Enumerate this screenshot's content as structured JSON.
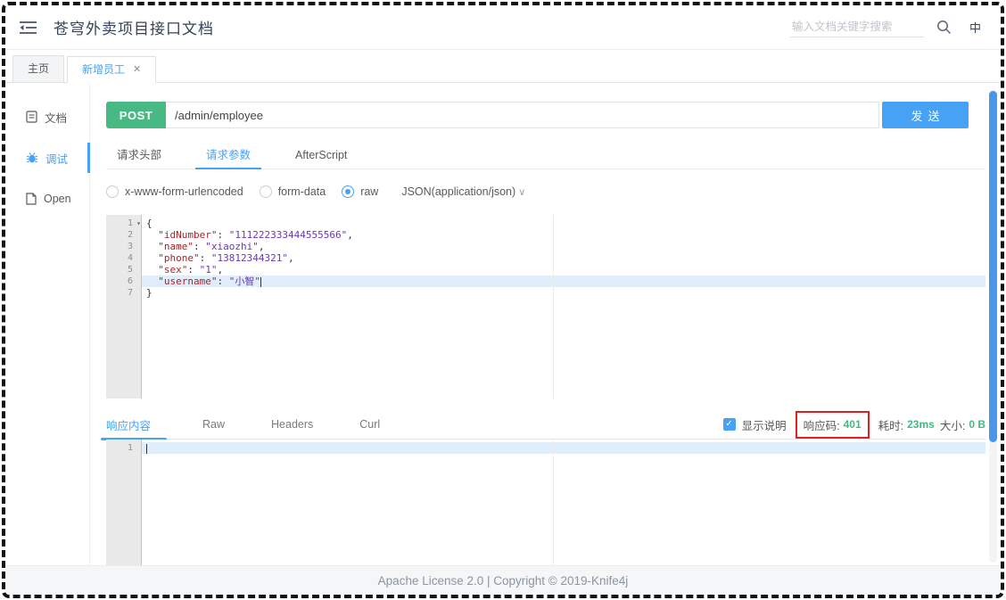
{
  "header": {
    "title": "苍穹外卖项目接口文档",
    "search_placeholder": "输入文档关键字搜索",
    "lang_label": "中"
  },
  "doc_tabs": {
    "home": "主页",
    "active": "新增员工",
    "close_glyph": "✕"
  },
  "sidebar": {
    "items": [
      {
        "label": "文档"
      },
      {
        "label": "调试"
      },
      {
        "label": "Open"
      }
    ]
  },
  "request": {
    "method": "POST",
    "url": "/admin/employee",
    "send_label": "发送",
    "tabs": [
      "请求头部",
      "请求参数",
      "AfterScript"
    ],
    "body_modes": [
      {
        "label": "x-www-form-urlencoded",
        "selected": false
      },
      {
        "label": "form-data",
        "selected": false
      },
      {
        "label": "raw",
        "selected": true
      }
    ],
    "content_type": "JSON(application/json)",
    "chevron_glyph": "∨"
  },
  "request_editor": {
    "fold_glyph": "▾",
    "line_numbers": [
      "1",
      "2",
      "3",
      "4",
      "5",
      "6",
      "7"
    ],
    "open_brace": "{",
    "close_brace": "}",
    "entries": [
      {
        "key": "\"idNumber\"",
        "colon": ": ",
        "value": "\"111222333444555566\"",
        "comma": ","
      },
      {
        "key": "\"name\"",
        "colon": ": ",
        "value": "\"xiaozhi\"",
        "comma": ","
      },
      {
        "key": "\"phone\"",
        "colon": ": ",
        "value": "\"13812344321\"",
        "comma": ","
      },
      {
        "key": "\"sex\"",
        "colon": ": ",
        "value": "\"1\"",
        "comma": ","
      },
      {
        "key": "\"username\"",
        "colon": ": ",
        "value": "\"小智\"",
        "comma": ""
      }
    ]
  },
  "response": {
    "tabs": [
      "响应内容",
      "Raw",
      "Headers",
      "Curl"
    ],
    "check_glyph": "✓",
    "show_desc_label": "显示说明",
    "status_label": "响应码:",
    "status_value": "401",
    "time_label": "耗时:",
    "time_value": "23ms",
    "size_label": "大小:",
    "size_value": "0 B",
    "editor_line_number": "1"
  },
  "footer": {
    "text": "Apache License 2.0 | Copyright © 2019-Knife4j"
  },
  "colors": {
    "accent_blue": "#47a1f5",
    "method_green": "#49b984",
    "status_green": "#42b983",
    "annotation_red": "#e02020",
    "json_key": "#a3262a",
    "json_value": "#6a36b8"
  }
}
